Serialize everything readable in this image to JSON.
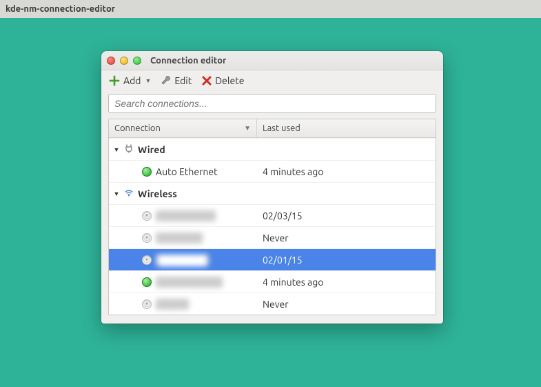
{
  "desktop": {
    "titlebar": "kde-nm-connection-editor"
  },
  "window": {
    "title": "Connection editor",
    "toolbar": {
      "add_label": "Add",
      "edit_label": "Edit",
      "delete_label": "Delete"
    },
    "search": {
      "placeholder": "Search connections..."
    },
    "columns": {
      "connection": "Connection",
      "last_used": "Last used"
    },
    "groups": [
      {
        "name": "Wired",
        "icon": "plug-icon",
        "items": [
          {
            "name": "Auto Ethernet",
            "last_used": "4 minutes ago",
            "active": true,
            "redacted": false,
            "selected": false
          }
        ]
      },
      {
        "name": "Wireless",
        "icon": "wifi-icon",
        "items": [
          {
            "name": "████████",
            "last_used": "02/03/15",
            "active": false,
            "redacted": true,
            "selected": false
          },
          {
            "name": "██████",
            "last_used": "Never",
            "active": false,
            "redacted": true,
            "selected": false
          },
          {
            "name": "███████",
            "last_used": "02/01/15",
            "active": false,
            "redacted": true,
            "selected": true
          },
          {
            "name": "█████████",
            "last_used": "4 minutes ago",
            "active": true,
            "redacted": true,
            "selected": false
          },
          {
            "name": "████",
            "last_used": "Never",
            "active": false,
            "redacted": true,
            "selected": false
          }
        ]
      }
    ]
  }
}
